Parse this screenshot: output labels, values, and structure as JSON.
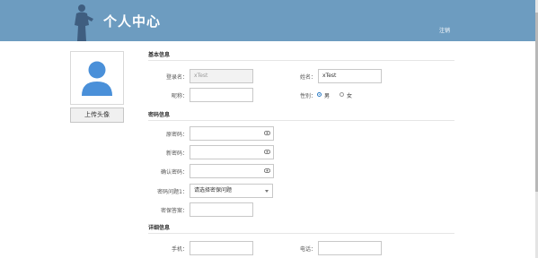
{
  "header": {
    "title": "个人中心",
    "logout": "注销"
  },
  "avatar": {
    "upload_label": "上传头像"
  },
  "basic": {
    "heading": "基本信息",
    "login_label": "登录名：",
    "login_value": "xTest",
    "name_label": "姓名：",
    "name_value": "xTest",
    "nickname_label": "昵称：",
    "nickname_value": "",
    "gender_label": "性别：",
    "gender_male": "男",
    "gender_female": "女",
    "gender_selected": "男"
  },
  "password": {
    "heading": "密码信息",
    "old_label": "原密码：",
    "new_label": "新密码：",
    "confirm_label": "确认密码：",
    "question_label": "密码问题1：",
    "question_value": "请选择密保问题",
    "answer_label": "密保答案："
  },
  "detail": {
    "heading": "详细信息",
    "mobile_label": "手机：",
    "mobile_value": "",
    "phone_label": "电话：",
    "phone_value": ""
  },
  "colors": {
    "header_bg": "#6d9cc0",
    "accent": "#2a7ac4"
  }
}
